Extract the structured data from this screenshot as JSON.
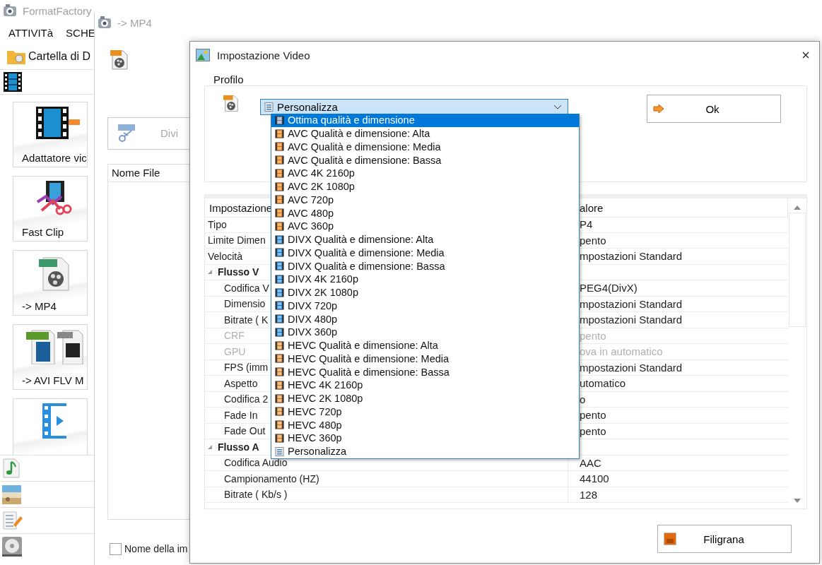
{
  "main_window": {
    "title": "FormatFactory",
    "menu": [
      "ATTIVITà",
      "SCHE"
    ],
    "toolbar": {
      "label": "Cartella di D"
    },
    "tools": [
      {
        "kind": "video-adapter",
        "label": "Adattatore vic"
      },
      {
        "kind": "fast-clip",
        "label": "Fast Clip"
      },
      {
        "kind": "mp4",
        "label": "-> MP4"
      },
      {
        "kind": "avi-flv",
        "label": "-> AVI FLV M"
      },
      {
        "kind": "film"
      }
    ],
    "categories": [
      {
        "kind": "audio"
      },
      {
        "kind": "picture"
      },
      {
        "kind": "document"
      },
      {
        "kind": "disc"
      }
    ]
  },
  "task_window": {
    "title": "-> MP4",
    "split_button": "Divi",
    "file_list": {
      "column": "Nome File"
    },
    "name_checkbox": {
      "label": "Nome della im",
      "checked": false
    }
  },
  "dialog": {
    "title": "Impostazione Video",
    "profile": {
      "label": "Profilo",
      "combo": "Personalizza",
      "expanded": true,
      "options": [
        {
          "kind": "generic",
          "label": "Ottima qualità e dimensione",
          "selected": true
        },
        {
          "kind": "avc",
          "label": "AVC Qualità e dimensione: Alta",
          "selected": false
        },
        {
          "kind": "avc",
          "label": "AVC Qualità e dimensione: Media",
          "selected": false
        },
        {
          "kind": "avc",
          "label": "AVC Qualità e dimensione: Bassa",
          "selected": false
        },
        {
          "kind": "avc",
          "label": "AVC 4K 2160p",
          "selected": false
        },
        {
          "kind": "avc",
          "label": "AVC 2K 1080p",
          "selected": false
        },
        {
          "kind": "avc",
          "label": "AVC 720p",
          "selected": false
        },
        {
          "kind": "avc",
          "label": "AVC 480p",
          "selected": false
        },
        {
          "kind": "avc",
          "label": "AVC 360p",
          "selected": false
        },
        {
          "kind": "divx",
          "label": "DIVX Qualità e dimensione: Alta",
          "selected": false
        },
        {
          "kind": "divx",
          "label": "DIVX Qualità e dimensione: Media",
          "selected": false
        },
        {
          "kind": "divx",
          "label": "DIVX Qualità e dimensione: Bassa",
          "selected": false
        },
        {
          "kind": "divx",
          "label": "DIVX 4K 2160p",
          "selected": false
        },
        {
          "kind": "divx",
          "label": "DIVX 2K 1080p",
          "selected": false
        },
        {
          "kind": "divx",
          "label": "DIVX 720p",
          "selected": false
        },
        {
          "kind": "divx",
          "label": "DIVX 480p",
          "selected": false
        },
        {
          "kind": "divx",
          "label": "DIVX 360p",
          "selected": false
        },
        {
          "kind": "hevc",
          "label": "HEVC Qualità e dimensione: Alta",
          "selected": false
        },
        {
          "kind": "hevc",
          "label": "HEVC Qualità e dimensione: Media",
          "selected": false
        },
        {
          "kind": "hevc",
          "label": "HEVC Qualità e dimensione: Bassa",
          "selected": false
        },
        {
          "kind": "hevc",
          "label": "HEVC 4K 2160p",
          "selected": false
        },
        {
          "kind": "hevc",
          "label": "HEVC 2K 1080p",
          "selected": false
        },
        {
          "kind": "hevc",
          "label": "HEVC 720p",
          "selected": false
        },
        {
          "kind": "hevc",
          "label": "HEVC 480p",
          "selected": false
        },
        {
          "kind": "hevc",
          "label": "HEVC 360p",
          "selected": false
        },
        {
          "kind": "custom",
          "label": "Personalizza",
          "selected": false
        }
      ]
    },
    "ok_button": "Ok",
    "table": {
      "columns": [
        "Impostazione",
        "alore"
      ],
      "rows": [
        {
          "kind": "setting",
          "name": "Tipo",
          "value": "P4",
          "disabled": false
        },
        {
          "kind": "setting",
          "name": "Limite Dimen",
          "value": "pento",
          "disabled": false
        },
        {
          "kind": "setting",
          "name": "Velocità",
          "value": "mpostazioni Standard",
          "disabled": false
        },
        {
          "kind": "group",
          "name": "Flusso V",
          "expanded": true
        },
        {
          "kind": "setting",
          "name": "Codifica V",
          "value": "PEG4(DivX)",
          "disabled": false
        },
        {
          "kind": "setting",
          "name": "Dimensio",
          "value": "mpostazioni Standard",
          "disabled": false
        },
        {
          "kind": "setting",
          "name": "Bitrate ( K",
          "value": "mpostazioni Standard",
          "disabled": false
        },
        {
          "kind": "setting",
          "name": "CRF",
          "value": "pento",
          "disabled": true
        },
        {
          "kind": "setting",
          "name": "GPU",
          "value": "ova in automatico",
          "disabled": true
        },
        {
          "kind": "setting",
          "name": "FPS (imm",
          "value": "mpostazioni Standard",
          "disabled": false
        },
        {
          "kind": "setting",
          "name": "Aspetto",
          "value": "utomatico",
          "disabled": false
        },
        {
          "kind": "setting",
          "name": "Codifica 2",
          "value": "o",
          "disabled": false
        },
        {
          "kind": "setting",
          "name": "Fade In",
          "value": "pento",
          "disabled": false
        },
        {
          "kind": "setting",
          "name": "Fade Out",
          "value": "pento",
          "disabled": false
        },
        {
          "kind": "group",
          "name": "Flusso A",
          "expanded": true
        },
        {
          "kind": "setting",
          "name": "Codifica Audio",
          "value": "AAC",
          "disabled": false
        },
        {
          "kind": "setting",
          "name": "Campionamento (HZ)",
          "value": "44100",
          "disabled": false
        },
        {
          "kind": "setting",
          "name": "Bitrate ( Kb/s )",
          "value": "128",
          "disabled": false
        }
      ]
    },
    "watermark_button": "Filigrana"
  }
}
